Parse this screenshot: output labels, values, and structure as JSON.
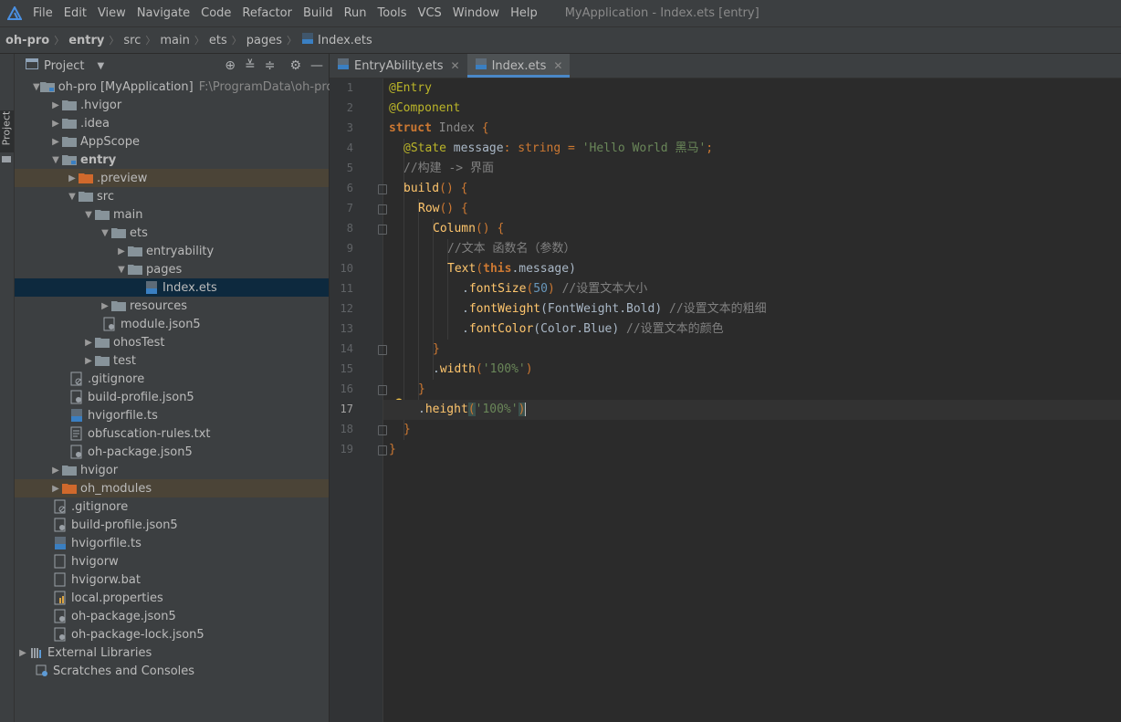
{
  "menubar": {
    "items": [
      "File",
      "Edit",
      "View",
      "Navigate",
      "Code",
      "Refactor",
      "Build",
      "Run",
      "Tools",
      "VCS",
      "Window",
      "Help"
    ],
    "window_title": "MyApplication - Index.ets [entry]"
  },
  "breadcrumbs": [
    "oh-pro",
    "entry",
    "src",
    "main",
    "ets",
    "pages",
    "Index.ets"
  ],
  "left_strip": {
    "label": "Project"
  },
  "project_panel": {
    "title": "Project",
    "root_name": "oh-pro [MyApplication]",
    "root_path": "F:\\ProgramData\\oh-pro",
    "items": [
      {
        "label": ".hvigor"
      },
      {
        "label": ".idea"
      },
      {
        "label": "AppScope"
      },
      {
        "label": "entry"
      },
      {
        "label": ".preview"
      },
      {
        "label": "src"
      },
      {
        "label": "main"
      },
      {
        "label": "ets"
      },
      {
        "label": "entryability"
      },
      {
        "label": "pages"
      },
      {
        "label": "Index.ets"
      },
      {
        "label": "resources"
      },
      {
        "label": "module.json5"
      },
      {
        "label": "ohosTest"
      },
      {
        "label": "test"
      },
      {
        "label": ".gitignore"
      },
      {
        "label": "build-profile.json5"
      },
      {
        "label": "hvigorfile.ts"
      },
      {
        "label": "obfuscation-rules.txt"
      },
      {
        "label": "oh-package.json5"
      },
      {
        "label": "hvigor"
      },
      {
        "label": "oh_modules"
      },
      {
        "label": ".gitignore"
      },
      {
        "label": "build-profile.json5"
      },
      {
        "label": "hvigorfile.ts"
      },
      {
        "label": "hvigorw"
      },
      {
        "label": "hvigorw.bat"
      },
      {
        "label": "local.properties"
      },
      {
        "label": "oh-package.json5"
      },
      {
        "label": "oh-package-lock.json5"
      },
      {
        "label": "External Libraries"
      },
      {
        "label": "Scratches and Consoles"
      }
    ]
  },
  "editor": {
    "tabs": [
      {
        "label": "EntryAbility.ets"
      },
      {
        "label": "Index.ets"
      }
    ],
    "line_numbers": [
      "1",
      "2",
      "3",
      "4",
      "5",
      "6",
      "7",
      "8",
      "9",
      "10",
      "11",
      "12",
      "13",
      "14",
      "15",
      "16",
      "17",
      "18",
      "19"
    ],
    "code": {
      "l1": "@Entry",
      "l2": "@Component",
      "l3_kw": "struct",
      "l3_name": " Index ",
      "l3_brace": "{",
      "l4_ann": "@State",
      "l4_var": " message",
      "l4_colon": ": ",
      "l4_type": "string",
      "l4_eq": " = ",
      "l4_str": "'Hello World 黑马'",
      "l4_end": ";",
      "l5": "//构建 -> 界面",
      "l6_fn": "build",
      "l6_rest": "() {",
      "l7_fn": "Row",
      "l7_rest": "() {",
      "l8_fn": "Column",
      "l8_rest": "() {",
      "l9": "//文本 函数名（参数）",
      "l10_fn": "Text",
      "l10_p1": "(",
      "l10_kw": "this",
      "l10_p2": ".message)",
      "l11_dot": ".",
      "l11_fn": "fontSize",
      "l11_p1": "(",
      "l11_num": "50",
      "l11_p2": ") ",
      "l11_com": "//设置文本大小",
      "l12_dot": ".",
      "l12_fn": "fontWeight",
      "l12_p": "(FontWeight.Bold) ",
      "l12_com": "//设置文本的粗细",
      "l13_dot": ".",
      "l13_fn": "fontColor",
      "l13_p": "(Color.Blue) ",
      "l13_com": "//设置文本的颜色",
      "l14": "}",
      "l15_dot": ".",
      "l15_fn": "width",
      "l15_p1": "(",
      "l15_str": "'100%'",
      "l15_p2": ")",
      "l16": "}",
      "l17_dot": ".",
      "l17_fn": "height",
      "l17_p1": "(",
      "l17_str": "'100%'",
      "l17_p2": ")",
      "l18": "}",
      "l19": "}"
    }
  },
  "colors": {
    "accent": "#4a88c7",
    "selection": "#0d293e",
    "highlight": "#4b4437"
  }
}
